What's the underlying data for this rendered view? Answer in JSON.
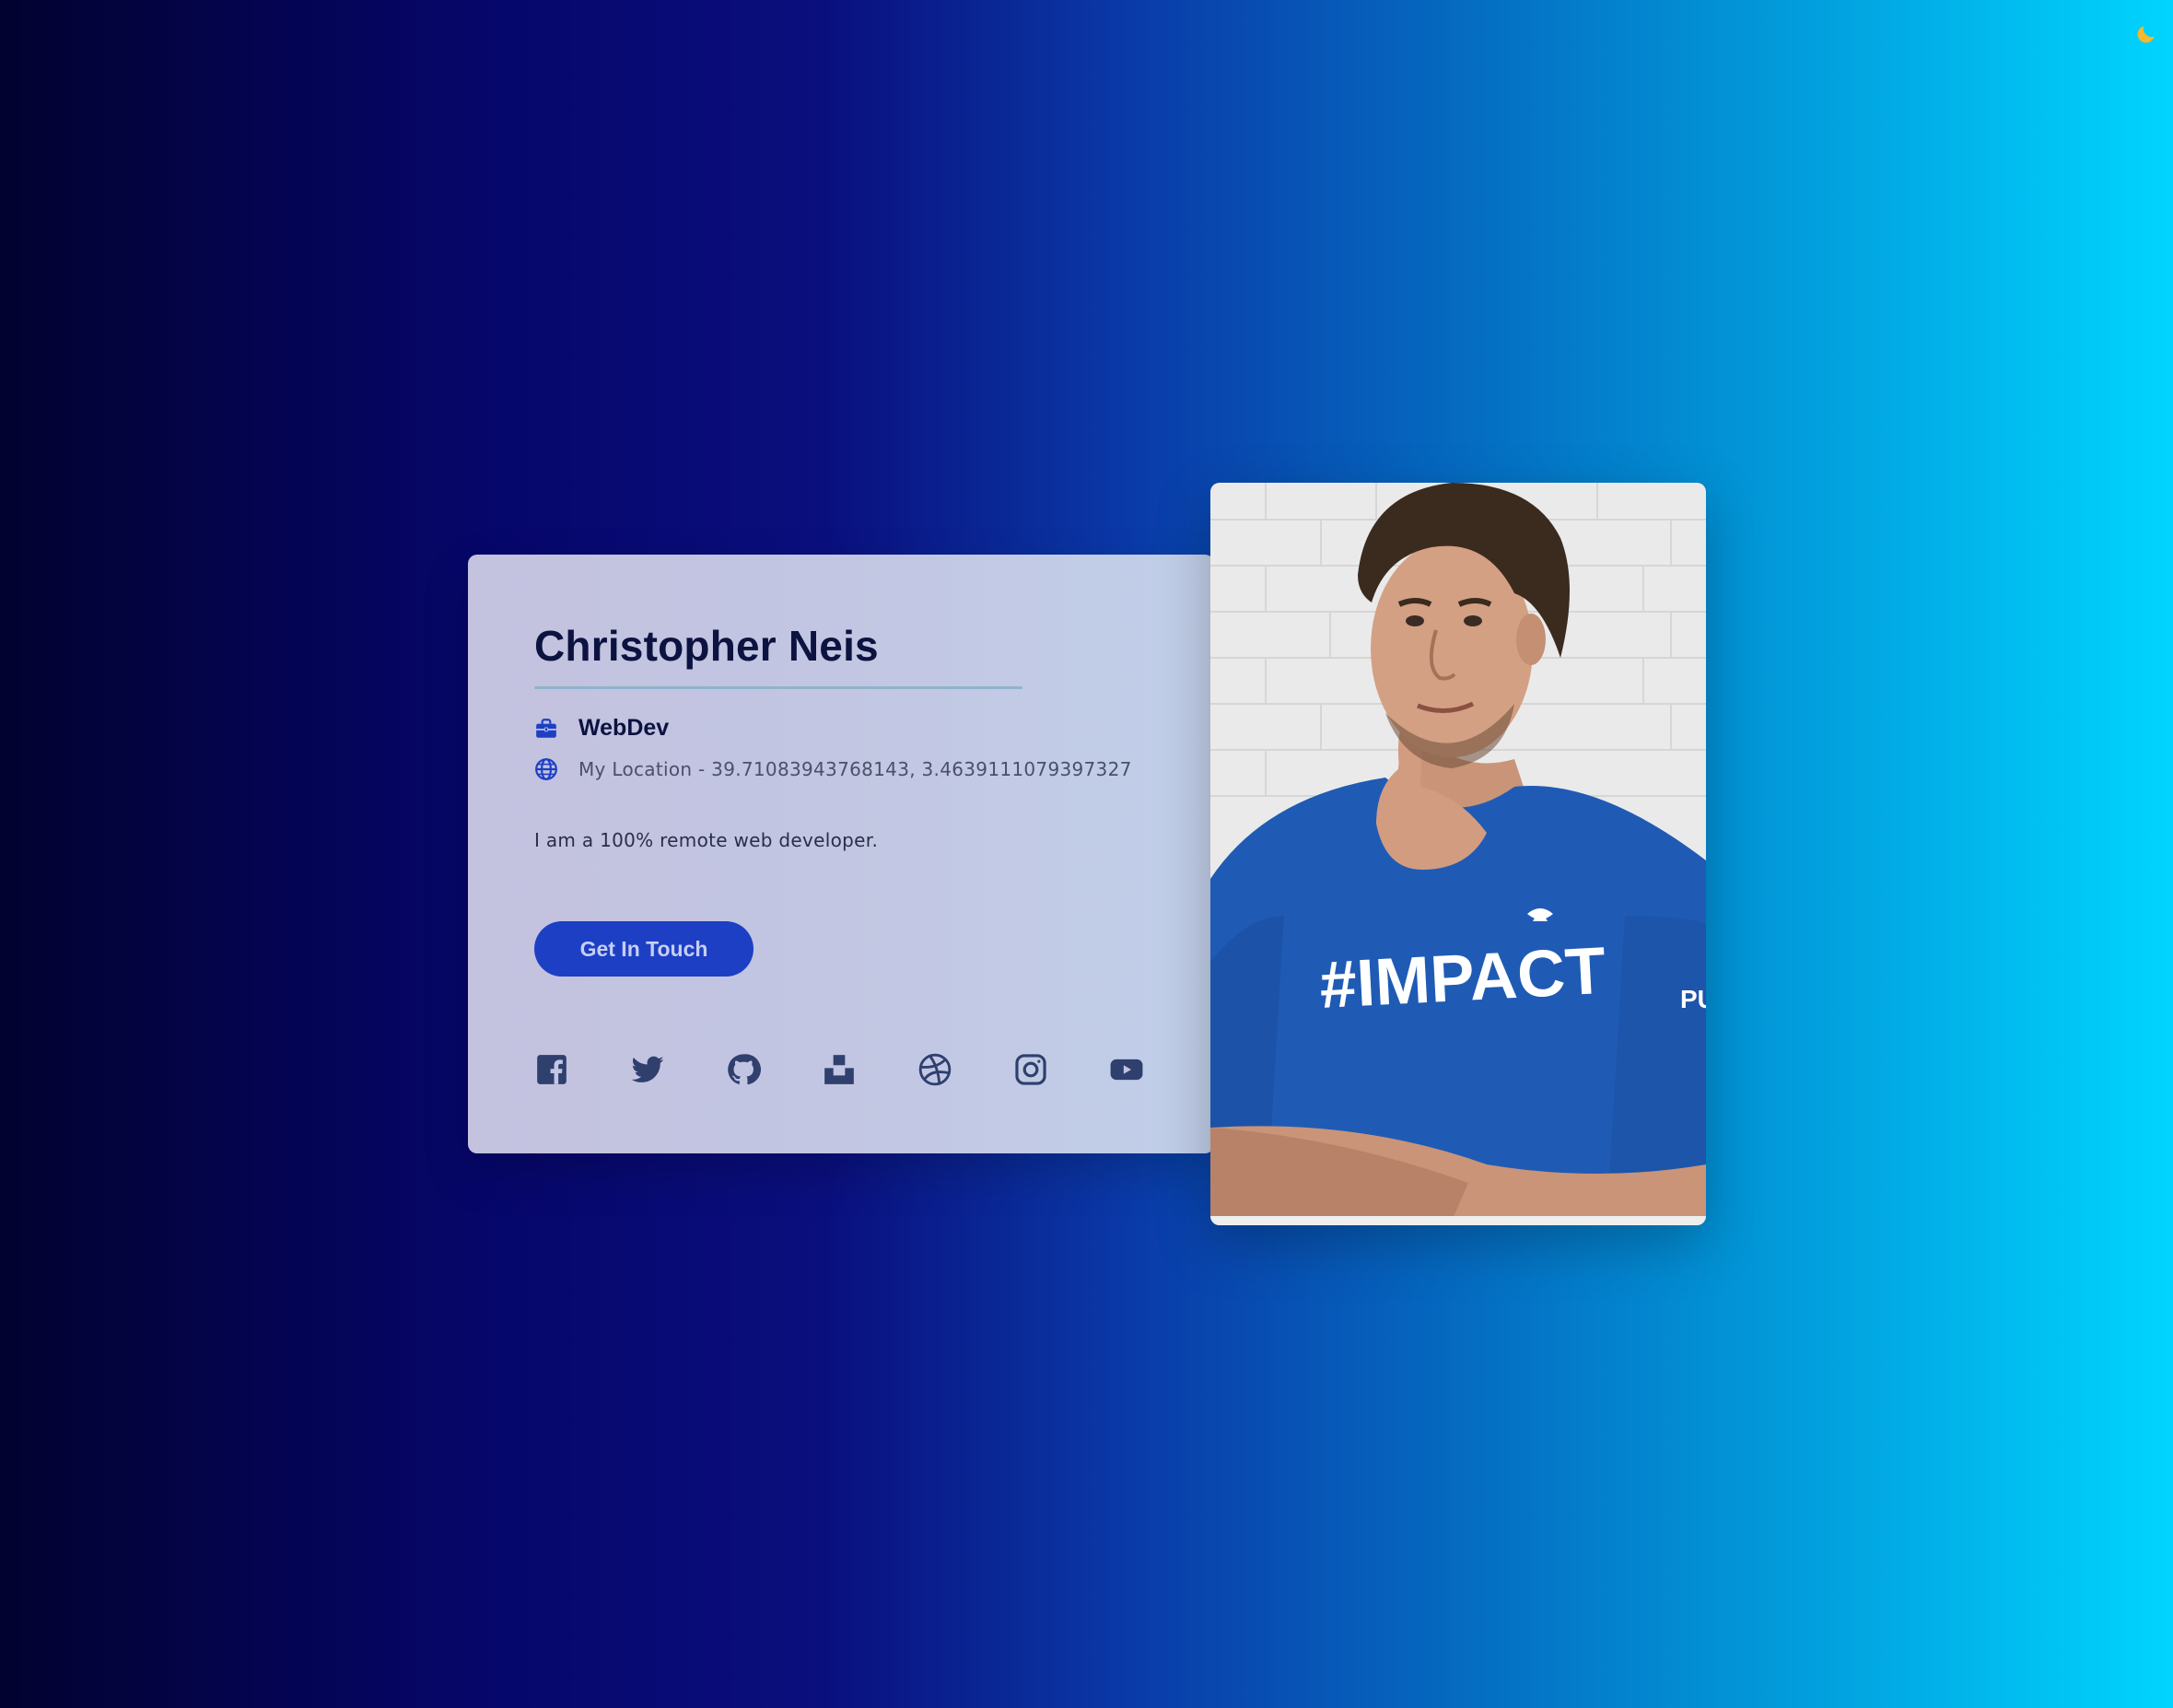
{
  "profile": {
    "name": "Christopher Neis",
    "job": "WebDev",
    "location": "My Location - 39.71083943768143, 3.4639111079397327",
    "bio": "I am a 100% remote web developer."
  },
  "cta": {
    "label": "Get In Touch"
  },
  "shirt": {
    "front_text": "#IMPACT",
    "sleeve_text": "PU"
  },
  "icons": {
    "theme": "moon-icon",
    "job": "briefcase-icon",
    "location": "globe-icon",
    "socials": [
      "facebook-icon",
      "twitter-icon",
      "github-icon",
      "unsplash-icon",
      "dribbble-icon",
      "instagram-icon",
      "youtube-icon"
    ]
  },
  "colors": {
    "accent": "#1d3fc4",
    "moon": "#f5b82e",
    "icon": "#2f3f6e",
    "name": "#0c1340"
  }
}
